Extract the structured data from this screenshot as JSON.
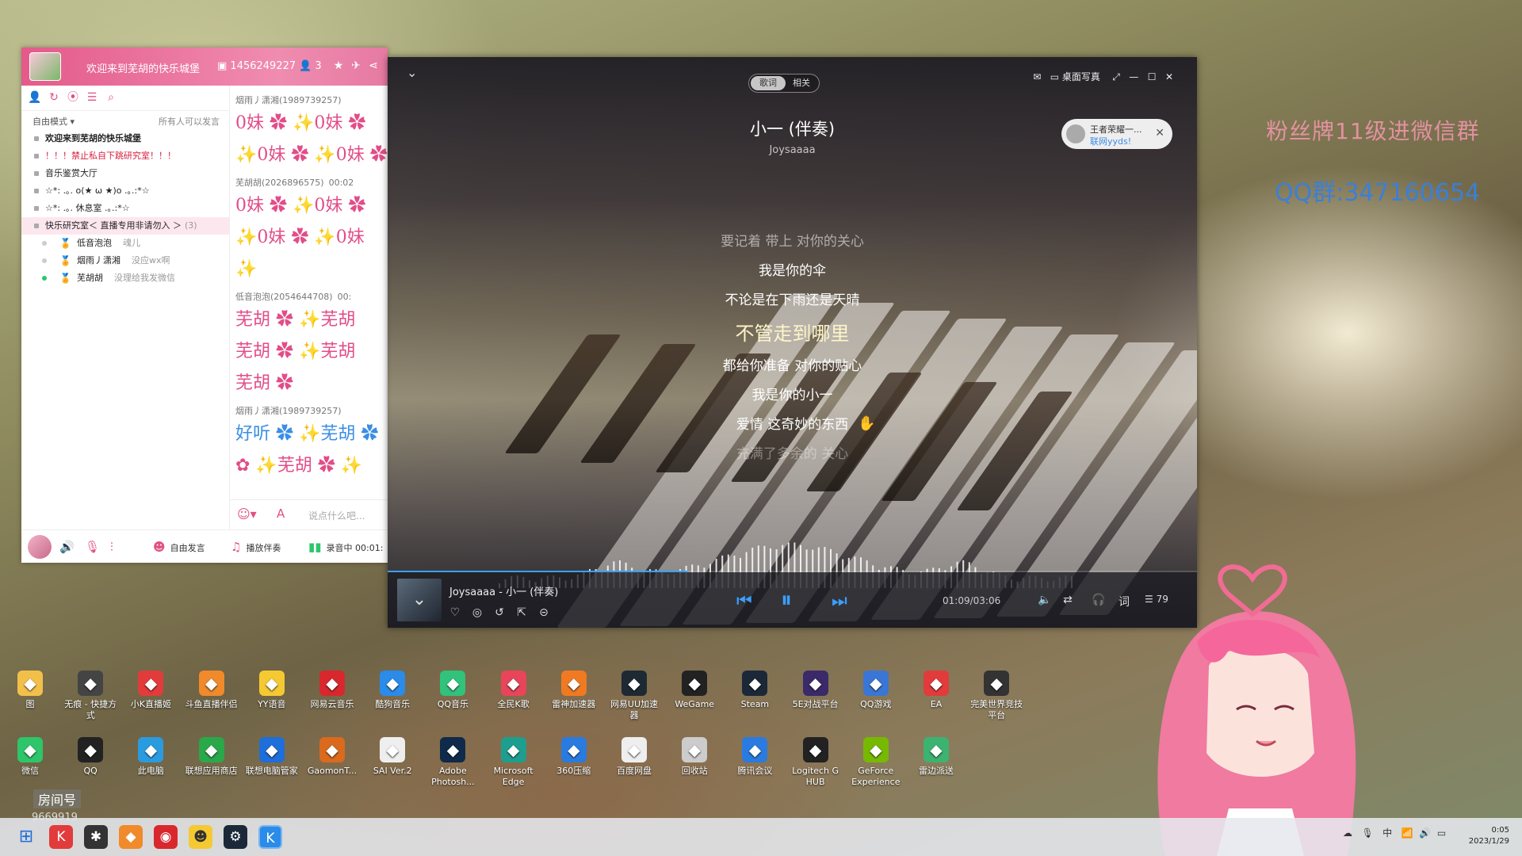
{
  "chat": {
    "title": "欢迎来到芜胡的快乐城堡",
    "room_id": "1456249227",
    "user_count": "3",
    "mode": "自由模式",
    "mode_note": "所有人可以发言",
    "rooms": [
      {
        "label": "欢迎来到芜胡的快乐城堡",
        "bold": true
      },
      {
        "label": "！！！禁止私自下跳研究室！！！",
        "red": true
      },
      {
        "label": "音乐鉴赏大厅"
      },
      {
        "label": "☆*: .｡. o(★ ω ★)o .｡.:*☆"
      },
      {
        "label": "☆*: .｡. 休息室 .｡.:*☆"
      },
      {
        "label": "快乐研究室＜ 直播专用非请勿入 ＞",
        "count": "(3)",
        "active": true
      }
    ],
    "members": [
      {
        "name": "低音泡泡",
        "tag": "魂儿"
      },
      {
        "name": "烟雨丿潇湘",
        "tag": "没应wx啊"
      },
      {
        "name": "芜胡胡",
        "tag": "没理给我发微信",
        "online": true
      }
    ],
    "messages": [
      {
        "sender": "烟雨丿潇湘(1989739257)",
        "lines": [
          "0妹 ✿ ✨0妹 ✿",
          "✨0妹 ✿ ✨0妹 ✿"
        ]
      },
      {
        "sender": "芜胡胡(2026896575)",
        "time": "00:02",
        "lines": [
          "0妹 ✿ ✨0妹 ✿",
          "✨0妹 ✿ ✨0妹",
          "✨"
        ]
      },
      {
        "sender": "低音泡泡(2054644708)",
        "time": "00:",
        "lines": [
          "芜胡 ✿ ✨芜胡",
          "芜胡 ✿ ✨芜胡",
          "芜胡 ✿"
        ]
      },
      {
        "sender": "烟雨丿潇湘(1989739257)",
        "lines": [
          "好听 ✿ ✨芜胡 ✿",
          "✿ ✨芜胡 ✿ ✨"
        ]
      }
    ],
    "input_placeholder": "说点什么吧...",
    "bottom": {
      "free_speak": "自由发言",
      "play_music": "播放伴奏",
      "recording": "录音中 00:01:"
    }
  },
  "player": {
    "tabs": [
      "歌词",
      "相关"
    ],
    "desktop_lyrics": "桌面写真",
    "title": "小一 (伴奏)",
    "artist": "Joysaaaa",
    "lyrics": [
      {
        "text": "要记着 带上 对你的关心",
        "state": "dim"
      },
      {
        "text": "我是你的伞",
        "state": "normal"
      },
      {
        "text": "不论是在下雨还是天晴",
        "state": "normal"
      },
      {
        "text": "不管走到哪里",
        "state": "current"
      },
      {
        "text": "都给你准备 对你的贴心",
        "state": "normal"
      },
      {
        "text": "我是你的小一",
        "state": "normal"
      },
      {
        "text": "爱情 这奇妙的东西",
        "state": "normal"
      },
      {
        "text": "充满了多余的 关心",
        "state": "faint"
      }
    ],
    "notification": {
      "name": "王者荣耀一...",
      "sub": "联网yyds!"
    },
    "now_playing": "Joysaaaa - 小一 (伴奏)",
    "time": "01:09/03:06",
    "playlist_count": "79",
    "progress": 0.37,
    "accent": "#3aa0ff"
  },
  "overlay": {
    "fans_text": "粉丝牌11级进微信群",
    "qq_text": "QQ群:347160654"
  },
  "desktop": {
    "row1": [
      {
        "label": "图",
        "icon": "folder-icon",
        "color": "#f2c04a"
      },
      {
        "label": "无痕 - 快捷方式",
        "icon": "ghost-icon",
        "color": "#444"
      },
      {
        "label": "小K直播姬",
        "icon": "kk-icon",
        "color": "#e23b3b"
      },
      {
        "label": "斗鱼直播伴侣",
        "icon": "fish-icon",
        "color": "#f08a2a"
      },
      {
        "label": "YY语音",
        "icon": "yy-icon",
        "color": "#f5c932"
      },
      {
        "label": "网易云音乐",
        "icon": "netease-icon",
        "color": "#d9272e"
      },
      {
        "label": "酷狗音乐",
        "icon": "kugou-icon",
        "color": "#2a8be8"
      },
      {
        "label": "QQ音乐",
        "icon": "qqmusic-icon",
        "color": "#31c27c"
      },
      {
        "label": "全民K歌",
        "icon": "karaoke-icon",
        "color": "#e8455a"
      },
      {
        "label": "雷神加速器",
        "icon": "thunder-icon",
        "color": "#f07a22"
      },
      {
        "label": "网易UU加速器",
        "icon": "uu-icon",
        "color": "#1d2a33"
      },
      {
        "label": "WeGame",
        "icon": "wegame-icon",
        "color": "#222"
      },
      {
        "label": "Steam",
        "icon": "steam-icon",
        "color": "#1b2838"
      },
      {
        "label": "5E对战平台",
        "icon": "fivee-icon",
        "color": "#3b2a6a"
      },
      {
        "label": "QQ游戏",
        "icon": "qqgame-icon",
        "color": "#3a76d6"
      },
      {
        "label": "EA",
        "icon": "ea-icon",
        "color": "#e23b3b"
      },
      {
        "label": "完美世界竞技平台",
        "icon": "perfect-icon",
        "color": "#333"
      }
    ],
    "row2": [
      {
        "label": "微信",
        "icon": "wechat-icon",
        "color": "#2ec56b"
      },
      {
        "label": "QQ",
        "icon": "qq-icon",
        "color": "#222"
      },
      {
        "label": "此电脑",
        "icon": "computer-icon",
        "color": "#2b9be0"
      },
      {
        "label": "联想应用商店",
        "icon": "store-icon",
        "color": "#2aa84a"
      },
      {
        "label": "联想电脑管家",
        "icon": "shield-icon",
        "color": "#1e6fd9"
      },
      {
        "label": "GaomonT...",
        "icon": "pen-icon",
        "color": "#d96a1e"
      },
      {
        "label": "SAI Ver.2",
        "icon": "sai-icon",
        "color": "#eee"
      },
      {
        "label": "Adobe Photosh...",
        "icon": "photoshop-icon",
        "color": "#0f2a4a"
      },
      {
        "label": "Microsoft Edge",
        "icon": "edge-icon",
        "color": "#1e9e8e"
      },
      {
        "label": "360压缩",
        "icon": "zip-icon",
        "color": "#2a7be0"
      },
      {
        "label": "百度网盘",
        "icon": "cloud-icon",
        "color": "#eee"
      },
      {
        "label": "回收站",
        "icon": "recycle-icon",
        "color": "#ccc"
      },
      {
        "label": "腾讯会议",
        "icon": "meeting-icon",
        "color": "#2a7be0"
      },
      {
        "label": "Logitech G HUB",
        "icon": "logitech-icon",
        "color": "#222"
      },
      {
        "label": "GeForce Experience",
        "icon": "nvidia-icon",
        "color": "#76b900"
      },
      {
        "label": "雷边派送",
        "icon": "sheet-icon",
        "color": "#3cb371"
      }
    ],
    "room_label": "房间号",
    "room_number": "9669919"
  },
  "taskbar": {
    "ime": "中",
    "time": "0:05",
    "date": "2023/1/29"
  }
}
